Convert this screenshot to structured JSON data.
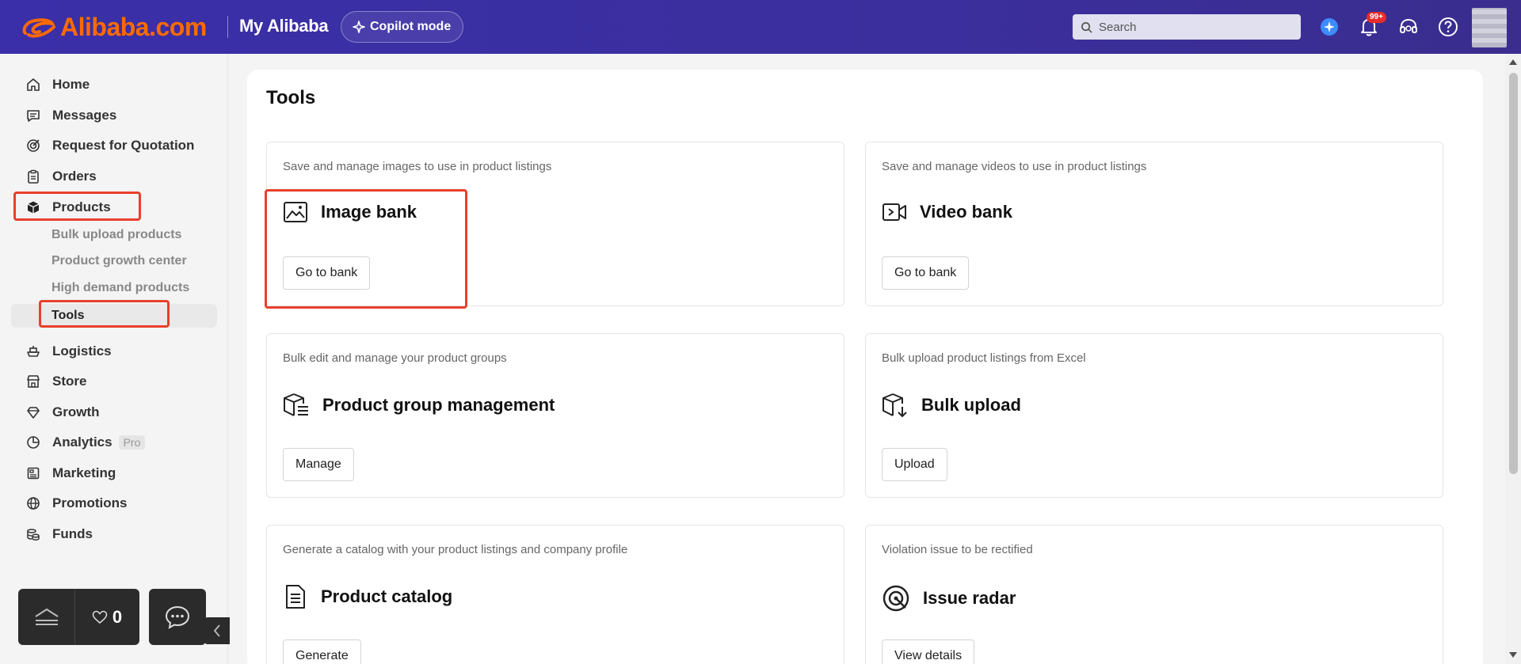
{
  "header": {
    "logo_text": "Alibaba.com",
    "title": "My Alibaba",
    "copilot_label": "Copilot mode",
    "search_placeholder": "Search",
    "notification_badge": "99+",
    "brand_color": "#ff6a00",
    "bar_color": "#3a2fa8"
  },
  "sidebar": {
    "items": [
      {
        "label": "Home",
        "icon": "home-icon"
      },
      {
        "label": "Messages",
        "icon": "message-icon"
      },
      {
        "label": "Request for Quotation",
        "icon": "target-icon"
      },
      {
        "label": "Orders",
        "icon": "clipboard-icon"
      },
      {
        "label": "Products",
        "icon": "cube-icon"
      },
      {
        "label": "Logistics",
        "icon": "ship-icon"
      },
      {
        "label": "Store",
        "icon": "store-icon"
      },
      {
        "label": "Growth",
        "icon": "diamond-icon"
      },
      {
        "label": "Analytics",
        "icon": "pie-chart-icon",
        "tag": "Pro"
      },
      {
        "label": "Marketing",
        "icon": "ad-icon"
      },
      {
        "label": "Promotions",
        "icon": "globe-icon"
      },
      {
        "label": "Funds",
        "icon": "coins-icon"
      }
    ],
    "product_subitems": [
      "Bulk upload products",
      "Product growth center",
      "High demand products",
      "Tools"
    ],
    "favorites_count": "0"
  },
  "main": {
    "title": "Tools",
    "cards": [
      {
        "desc": "Save and manage images to use in product listings",
        "title": "Image bank",
        "button": "Go to bank",
        "icon": "image-icon"
      },
      {
        "desc": "Save and manage videos to use in product listings",
        "title": "Video bank",
        "button": "Go to bank",
        "icon": "video-icon"
      },
      {
        "desc": "Bulk edit and manage your product groups",
        "title": "Product group management",
        "button": "Manage",
        "icon": "box-list-icon"
      },
      {
        "desc": "Bulk upload product listings from Excel",
        "title": "Bulk upload",
        "button": "Upload",
        "icon": "box-download-icon"
      },
      {
        "desc": "Generate a catalog with your product listings and company profile",
        "title": "Product catalog",
        "button": "Generate",
        "icon": "document-icon"
      },
      {
        "desc": "Violation issue to be rectified",
        "title": "Issue radar",
        "button": "View details",
        "icon": "radar-icon"
      }
    ]
  },
  "highlight_color": "#e8402c"
}
